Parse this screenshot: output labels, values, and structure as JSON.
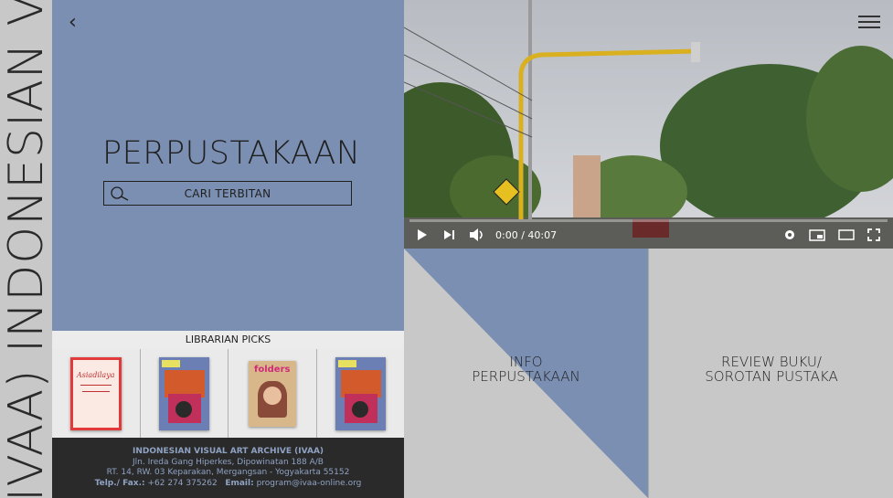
{
  "rail": {
    "text": "(IVAA)  INDONESIAN VI"
  },
  "library": {
    "title": "PERPUSTAKAAN",
    "search_label": "CARI TERBITAN"
  },
  "picks": {
    "heading": "LIBRARIAN PICKS",
    "books": [
      {
        "cover_color": "#e03a3a",
        "title": "Asiadilaya"
      },
      {
        "cover_color": "#6b7fb5",
        "title": ""
      },
      {
        "cover_color": "#d8b88a",
        "title": "folders"
      },
      {
        "cover_color": "#6b7fb5",
        "title": ""
      }
    ]
  },
  "footer": {
    "org": "INDONESIAN VISUAL ART ARCHIVE (IVAA)",
    "line1": "Jln. Ireda Gang Hiperkes, Dipowinatan 188 A/B",
    "line2": "RT. 14, RW. 03 Keparakan, Mergangsan - Yogyakarta 55152",
    "telp_label": "Telp./ Fax.:",
    "telp": "+62 274 375262",
    "email_label": "Email:",
    "email": "program@ivaa-online.org"
  },
  "video": {
    "time": "0:00 / 40:07",
    "progress": 0
  },
  "tiles": {
    "info_line1": "INFO",
    "info_line2": "PERPUSTAKAAN",
    "review_line1": "REVIEW BUKU/",
    "review_line2": "SOROTAN PUSTAKA"
  },
  "colors": {
    "accent": "#7b8fb3",
    "dark": "#2a2a2a",
    "gray": "#c8c8c8"
  }
}
